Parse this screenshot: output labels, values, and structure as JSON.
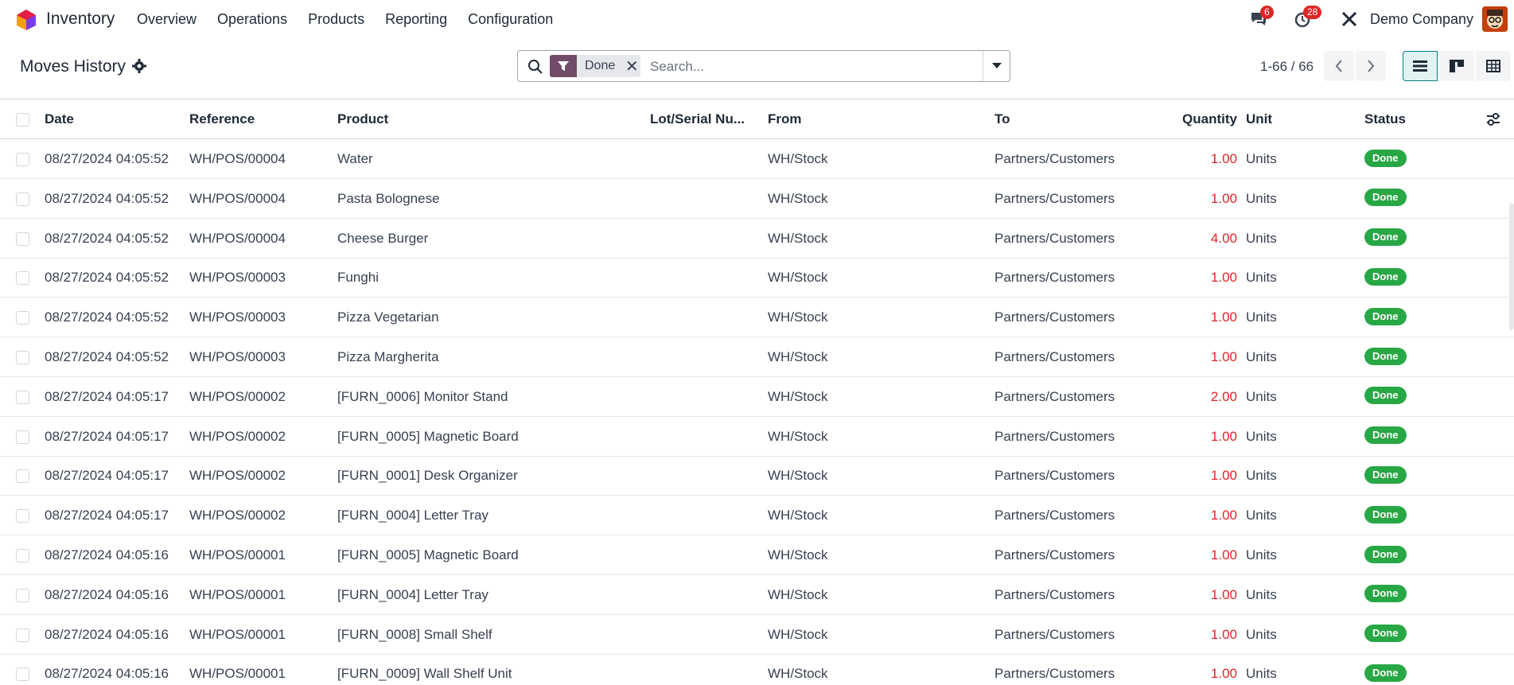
{
  "navbar": {
    "app_name": "Inventory",
    "menu": [
      "Overview",
      "Operations",
      "Products",
      "Reporting",
      "Configuration"
    ],
    "messages_count": "6",
    "activities_count": "28",
    "company": "Demo Company",
    "icons": [
      "app-logo-icon",
      "chat-icon",
      "clock-icon",
      "tools-icon",
      "avatar"
    ]
  },
  "control": {
    "title": "Moves History",
    "facet_label": "Done",
    "search_placeholder": "Search...",
    "pager": "1-66 / 66"
  },
  "table": {
    "columns": [
      "Date",
      "Reference",
      "Product",
      "Lot/Serial Nu...",
      "From",
      "To",
      "Quantity",
      "Unit",
      "Status"
    ],
    "rows": [
      {
        "date": "08/27/2024 04:05:52",
        "ref": "WH/POS/00004",
        "product": "Water",
        "lot": "",
        "from": "WH/Stock",
        "to": "Partners/Customers",
        "qty": "1.00",
        "unit": "Units",
        "status": "Done"
      },
      {
        "date": "08/27/2024 04:05:52",
        "ref": "WH/POS/00004",
        "product": "Pasta Bolognese",
        "lot": "",
        "from": "WH/Stock",
        "to": "Partners/Customers",
        "qty": "1.00",
        "unit": "Units",
        "status": "Done"
      },
      {
        "date": "08/27/2024 04:05:52",
        "ref": "WH/POS/00004",
        "product": "Cheese Burger",
        "lot": "",
        "from": "WH/Stock",
        "to": "Partners/Customers",
        "qty": "4.00",
        "unit": "Units",
        "status": "Done"
      },
      {
        "date": "08/27/2024 04:05:52",
        "ref": "WH/POS/00003",
        "product": "Funghi",
        "lot": "",
        "from": "WH/Stock",
        "to": "Partners/Customers",
        "qty": "1.00",
        "unit": "Units",
        "status": "Done"
      },
      {
        "date": "08/27/2024 04:05:52",
        "ref": "WH/POS/00003",
        "product": "Pizza Vegetarian",
        "lot": "",
        "from": "WH/Stock",
        "to": "Partners/Customers",
        "qty": "1.00",
        "unit": "Units",
        "status": "Done"
      },
      {
        "date": "08/27/2024 04:05:52",
        "ref": "WH/POS/00003",
        "product": "Pizza Margherita",
        "lot": "",
        "from": "WH/Stock",
        "to": "Partners/Customers",
        "qty": "1.00",
        "unit": "Units",
        "status": "Done"
      },
      {
        "date": "08/27/2024 04:05:17",
        "ref": "WH/POS/00002",
        "product": "[FURN_0006] Monitor Stand",
        "lot": "",
        "from": "WH/Stock",
        "to": "Partners/Customers",
        "qty": "2.00",
        "unit": "Units",
        "status": "Done"
      },
      {
        "date": "08/27/2024 04:05:17",
        "ref": "WH/POS/00002",
        "product": "[FURN_0005] Magnetic Board",
        "lot": "",
        "from": "WH/Stock",
        "to": "Partners/Customers",
        "qty": "1.00",
        "unit": "Units",
        "status": "Done"
      },
      {
        "date": "08/27/2024 04:05:17",
        "ref": "WH/POS/00002",
        "product": "[FURN_0001] Desk Organizer",
        "lot": "",
        "from": "WH/Stock",
        "to": "Partners/Customers",
        "qty": "1.00",
        "unit": "Units",
        "status": "Done"
      },
      {
        "date": "08/27/2024 04:05:17",
        "ref": "WH/POS/00002",
        "product": "[FURN_0004] Letter Tray",
        "lot": "",
        "from": "WH/Stock",
        "to": "Partners/Customers",
        "qty": "1.00",
        "unit": "Units",
        "status": "Done"
      },
      {
        "date": "08/27/2024 04:05:16",
        "ref": "WH/POS/00001",
        "product": "[FURN_0005] Magnetic Board",
        "lot": "",
        "from": "WH/Stock",
        "to": "Partners/Customers",
        "qty": "1.00",
        "unit": "Units",
        "status": "Done"
      },
      {
        "date": "08/27/2024 04:05:16",
        "ref": "WH/POS/00001",
        "product": "[FURN_0004] Letter Tray",
        "lot": "",
        "from": "WH/Stock",
        "to": "Partners/Customers",
        "qty": "1.00",
        "unit": "Units",
        "status": "Done"
      },
      {
        "date": "08/27/2024 04:05:16",
        "ref": "WH/POS/00001",
        "product": "[FURN_0008] Small Shelf",
        "lot": "",
        "from": "WH/Stock",
        "to": "Partners/Customers",
        "qty": "1.00",
        "unit": "Units",
        "status": "Done"
      },
      {
        "date": "08/27/2024 04:05:16",
        "ref": "WH/POS/00001",
        "product": "[FURN_0009] Wall Shelf Unit",
        "lot": "",
        "from": "WH/Stock",
        "to": "Partners/Customers",
        "qty": "1.00",
        "unit": "Units",
        "status": "Done"
      }
    ]
  },
  "colors": {
    "brand": "#714b67",
    "accent": "#017e84",
    "qty_red": "#dc2626",
    "status_green": "#28a745"
  }
}
